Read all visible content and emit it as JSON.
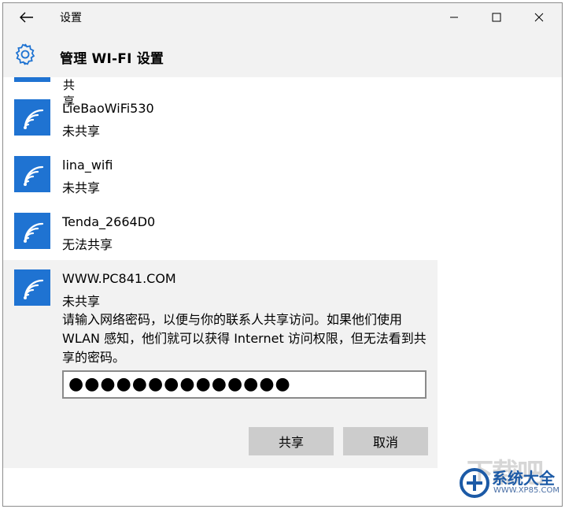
{
  "window": {
    "title": "设置"
  },
  "header": {
    "title": "管理 WI-FI 设置"
  },
  "partial_item": {
    "status": "未共享"
  },
  "networks": [
    {
      "name": "LieBaoWiFi530",
      "status": "未共享"
    },
    {
      "name": "lina_wifi",
      "status": "未共享"
    },
    {
      "name": "Tenda_2664D0",
      "status": "无法共享"
    }
  ],
  "expanded": {
    "name": "WWW.PC841.COM",
    "status": "未共享",
    "description": "请输入网络密码，以便与你的联系人共享访问。如果他们使用 WLAN 感知，他们就可以获得 Internet 访问权限，但无法看到共享的密码。",
    "password_mask": "●●●●●●●●●●●●●●",
    "share_label": "共享",
    "cancel_label": "取消"
  },
  "watermark": {
    "text": "系统大全",
    "url": "WWW.XP85.COM",
    "bg_text": "下载吧"
  },
  "colors": {
    "accent": "#1f73d2",
    "chrome": "#f2f2f2",
    "button": "#cccccc"
  }
}
